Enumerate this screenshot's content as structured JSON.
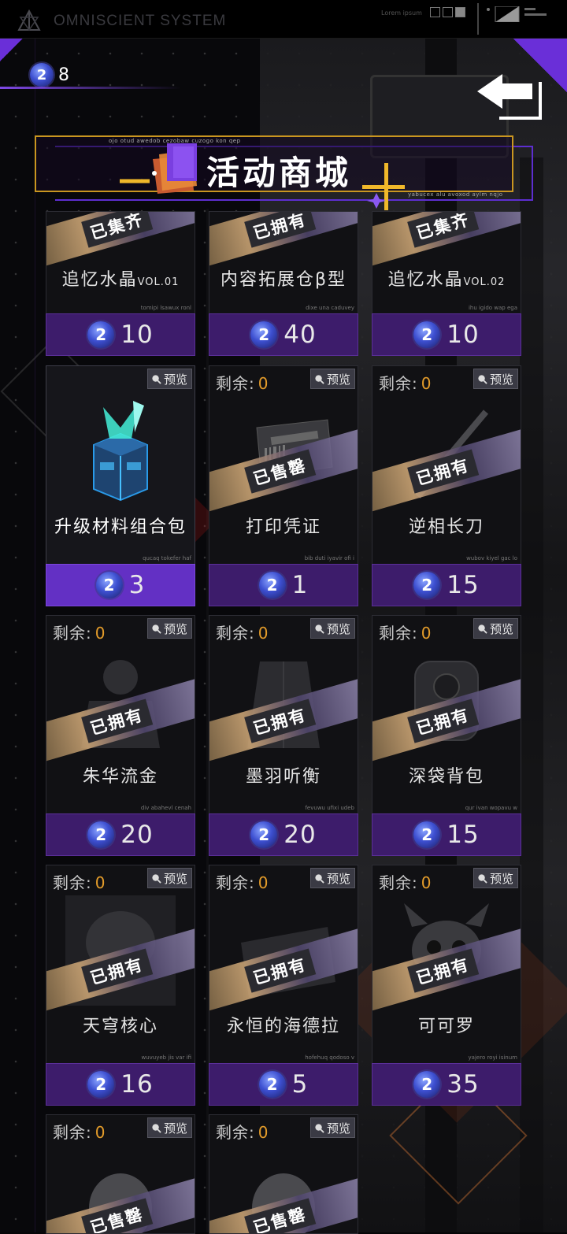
{
  "system": {
    "title": "OMNISCIENT SYSTEM",
    "lorem": "Lorem ipsum"
  },
  "currency": {
    "icon": "coin-icon",
    "value": "8"
  },
  "banner": {
    "title": "活动商城",
    "tiny_top": "ojo otud awedob cezobaw cuzogo kon qep",
    "tiny_bottom": "yabucex alu avoxod aylm nqjo"
  },
  "labels": {
    "remain": "剩余:",
    "preview": "预览"
  },
  "colors": {
    "accent": "#6330c4",
    "price_bar": "#3d1c6b",
    "remain_num": "#e49c2a",
    "banner_border": "#c99620"
  },
  "items_top": [
    {
      "stamp": "已集齐",
      "name": "追忆水晶",
      "vol": "VOL.01",
      "tiny": "tomipi lsawux ronl",
      "price": "10"
    },
    {
      "stamp": "已拥有",
      "name": "内容拓展仓β型",
      "vol": "",
      "tiny": "dixe una caduvey",
      "price": "40"
    },
    {
      "stamp": "已集齐",
      "name": "追忆水晶",
      "vol": "VOL.02",
      "tiny": "ihu igido wap ega",
      "price": "10"
    }
  ],
  "items": [
    {
      "remain": "",
      "stamp": "",
      "name": "升级材料组合包",
      "tiny": "qucaq tokefer haf",
      "price": "3",
      "selected": true
    },
    {
      "remain": "0",
      "stamp": "已售罄",
      "name": "打印凭证",
      "tiny": "bib duti iyavir ofi i",
      "price": "1"
    },
    {
      "remain": "0",
      "stamp": "已拥有",
      "name": "逆相长刀",
      "tiny": "wubov kiyel gac lo",
      "price": "15"
    },
    {
      "remain": "0",
      "stamp": "已拥有",
      "name": "朱华流金",
      "tiny": "div abahevl cenah",
      "price": "20"
    },
    {
      "remain": "0",
      "stamp": "已拥有",
      "name": "墨羽听衡",
      "tiny": "fevuwu ufixi udeb",
      "price": "20"
    },
    {
      "remain": "0",
      "stamp": "已拥有",
      "name": "深袋背包",
      "tiny": "qur ivan wopavu w",
      "price": "15"
    },
    {
      "remain": "0",
      "stamp": "已拥有",
      "name": "天穹核心",
      "tiny": "wuvuyeb jis var ifi",
      "price": "16"
    },
    {
      "remain": "0",
      "stamp": "已拥有",
      "name": "永恒的海德拉",
      "tiny": "hofehuq qodoso v",
      "price": "5"
    },
    {
      "remain": "0",
      "stamp": "已拥有",
      "name": "可可罗",
      "tiny": "yajero royi isinum",
      "price": "35"
    },
    {
      "remain": "0",
      "stamp": "已售罄",
      "name": "",
      "tiny": "",
      "price": ""
    },
    {
      "remain": "0",
      "stamp": "已售罄",
      "name": "",
      "tiny": "",
      "price": ""
    }
  ]
}
